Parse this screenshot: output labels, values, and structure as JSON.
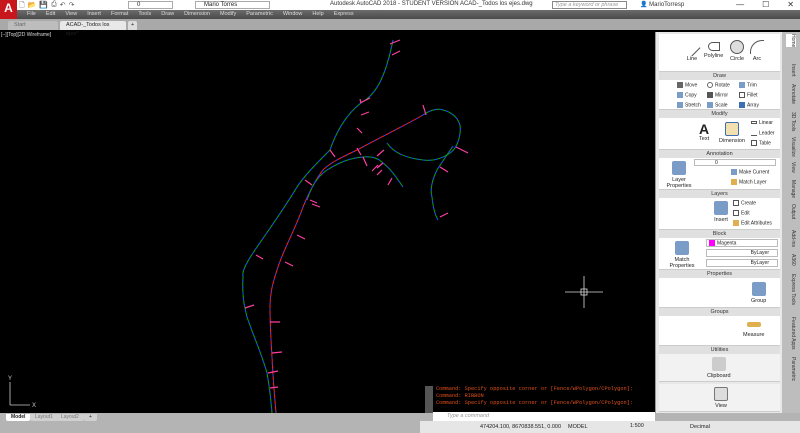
{
  "app": {
    "logo": "A",
    "title": "Autodesk AutoCAD 2018 - STUDENT VERSION    ACAD-_Todos los ejes.dwg",
    "layer_value": "0",
    "workspace": "Mario Torres",
    "search_placeholder": "Type a keyword or phrase",
    "user": "MarioTorresp",
    "window_controls": [
      "—",
      "☐",
      "✕"
    ]
  },
  "menu": [
    "File",
    "Edit",
    "View",
    "Insert",
    "Format",
    "Tools",
    "Draw",
    "Dimension",
    "Modify",
    "Parametric",
    "Window",
    "Help",
    "Express"
  ],
  "file_tabs": [
    {
      "label": "Start"
    },
    {
      "label": "ACAD-_Todos los ejes*"
    },
    {
      "label": "+"
    }
  ],
  "viewport_label": "[−][Top][2D Wireframe]",
  "ribbon": {
    "draw": {
      "label": "Draw",
      "tools": [
        "Line",
        "Polyline",
        "Circle",
        "Arc"
      ]
    },
    "modify": {
      "label": "Modify",
      "tools": [
        "Move",
        "Rotate",
        "Trim",
        "Copy",
        "Mirror",
        "Fillet",
        "Stretch",
        "Scale",
        "Array"
      ]
    },
    "annotation": {
      "label": "Annotation",
      "tools": [
        "Text",
        "Dimension",
        "Linear",
        "Leader",
        "Table"
      ]
    },
    "layers": {
      "label": "Layers",
      "tools": [
        "Layer Properties",
        "Make Current",
        "Match Layer"
      ],
      "current": "0"
    },
    "block": {
      "label": "Block",
      "tools": [
        "Insert",
        "Create",
        "Edit",
        "Edit Attributes"
      ]
    },
    "properties": {
      "label": "Properties",
      "tools": [
        "Match Properties"
      ],
      "color": "Magenta",
      "linetype": "ByLayer",
      "lineweight": "ByLayer",
      "color_hex": "#ff00ff"
    },
    "groups": {
      "label": "Groups",
      "tools": [
        "Group"
      ]
    },
    "utilities": {
      "label": "Utilities",
      "tools": [
        "Measure"
      ]
    },
    "clipboard": {
      "label": "Clipboard"
    },
    "view": {
      "label": "View"
    }
  },
  "side_tabs": [
    "Home",
    "Insert",
    "Annotate",
    "3D Tools",
    "Visualize",
    "View",
    "Manage",
    "Output",
    "Add-ins",
    "A360",
    "Express Tools",
    "Featured Apps",
    "Parametric"
  ],
  "command": {
    "history": [
      "Command: Specify opposite corner or [Fence/WPolygon/CPolygon]:",
      "Command: RIBBON",
      "Command: Specify opposite corner or [Fence/WPolygon/CPolygon]:"
    ],
    "placeholder": "Type a command"
  },
  "layout_tabs": [
    "Model",
    "Layout1",
    "Layout2",
    "+"
  ],
  "status": {
    "coords": "474204.100, 8670838.551, 0.000",
    "mode": "MODEL",
    "scale": "1:500",
    "units": "Decimal"
  },
  "ucs": {
    "x": "X",
    "y": "Y"
  }
}
